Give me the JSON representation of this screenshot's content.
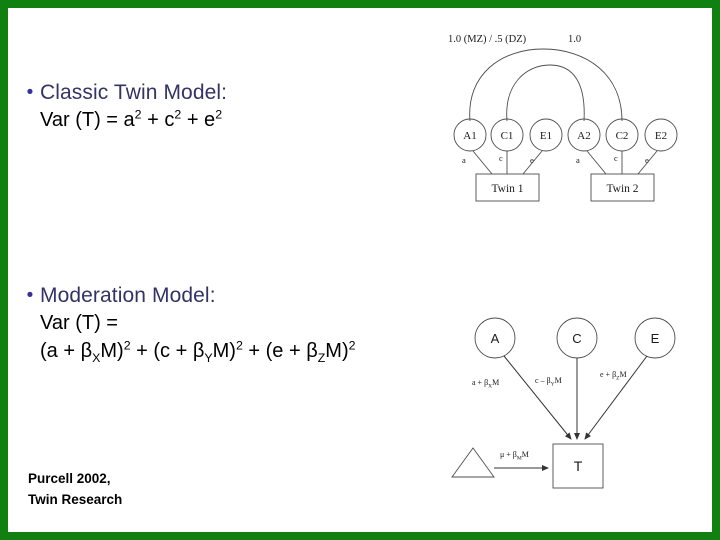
{
  "slide": {
    "border_color": "#108010",
    "background_color": "#ffffff",
    "heading_color": "#333366",
    "body_color": "#000000"
  },
  "bullets": [
    {
      "marker": "•",
      "heading": "Classic Twin Model:",
      "lines": [
        {
          "parts": [
            {
              "t": "Var (T) = a",
              "k": "n"
            },
            {
              "t": "2",
              "k": "sup"
            },
            {
              "t": " + c",
              "k": "n"
            },
            {
              "t": "2",
              "k": "sup"
            },
            {
              "t": " + e",
              "k": "n"
            },
            {
              "t": "2",
              "k": "sup"
            }
          ]
        }
      ]
    },
    {
      "marker": "•",
      "heading": "Moderation Model:",
      "lines": [
        {
          "parts": [
            {
              "t": "Var (T) =",
              "k": "n"
            }
          ]
        },
        {
          "parts": [
            {
              "t": "(a + β",
              "k": "n"
            },
            {
              "t": "X",
              "k": "sub"
            },
            {
              "t": "M)",
              "k": "n"
            },
            {
              "t": "2",
              "k": "sup"
            },
            {
              "t": " + (c + β",
              "k": "n"
            },
            {
              "t": "Y",
              "k": "sub"
            },
            {
              "t": "M)",
              "k": "n"
            },
            {
              "t": "2",
              "k": "sup"
            },
            {
              "t": " + (e + β",
              "k": "n"
            },
            {
              "t": "Z",
              "k": "sub"
            },
            {
              "t": "M)",
              "k": "n"
            },
            {
              "t": "2",
              "k": "sup"
            }
          ]
        }
      ]
    }
  ],
  "citation": {
    "line1": "Purcell 2002,",
    "line2": "Twin Research"
  },
  "figures": {
    "classic_twin": {
      "name": "classic-twin-path-diagram",
      "correlations": [
        {
          "label": "1.0 (MZ) / .5 (DZ)",
          "connects": "A1-A2"
        },
        {
          "label": "1.0",
          "connects": "C1-C2"
        }
      ],
      "latent_nodes": [
        "A1",
        "C1",
        "E1",
        "A2",
        "C2",
        "E2"
      ],
      "path_labels": [
        "a",
        "c",
        "e",
        "a",
        "c",
        "e"
      ],
      "observed_boxes": [
        "Twin 1",
        "Twin 2"
      ]
    },
    "moderation": {
      "name": "moderation-path-diagram",
      "latent_nodes": [
        "A",
        "C",
        "E"
      ],
      "path_labels": [
        {
          "main": "a + β",
          "sub": "X",
          "tail": "M"
        },
        {
          "main": "c – β",
          "sub": "Y",
          "tail": "M"
        },
        {
          "main": "e + β",
          "sub": "Z",
          "tail": "M"
        }
      ],
      "mean_label": {
        "main": "μ + β",
        "sub": "M",
        "tail": "M"
      },
      "observed_box": "T",
      "constant_shape": "triangle"
    }
  }
}
